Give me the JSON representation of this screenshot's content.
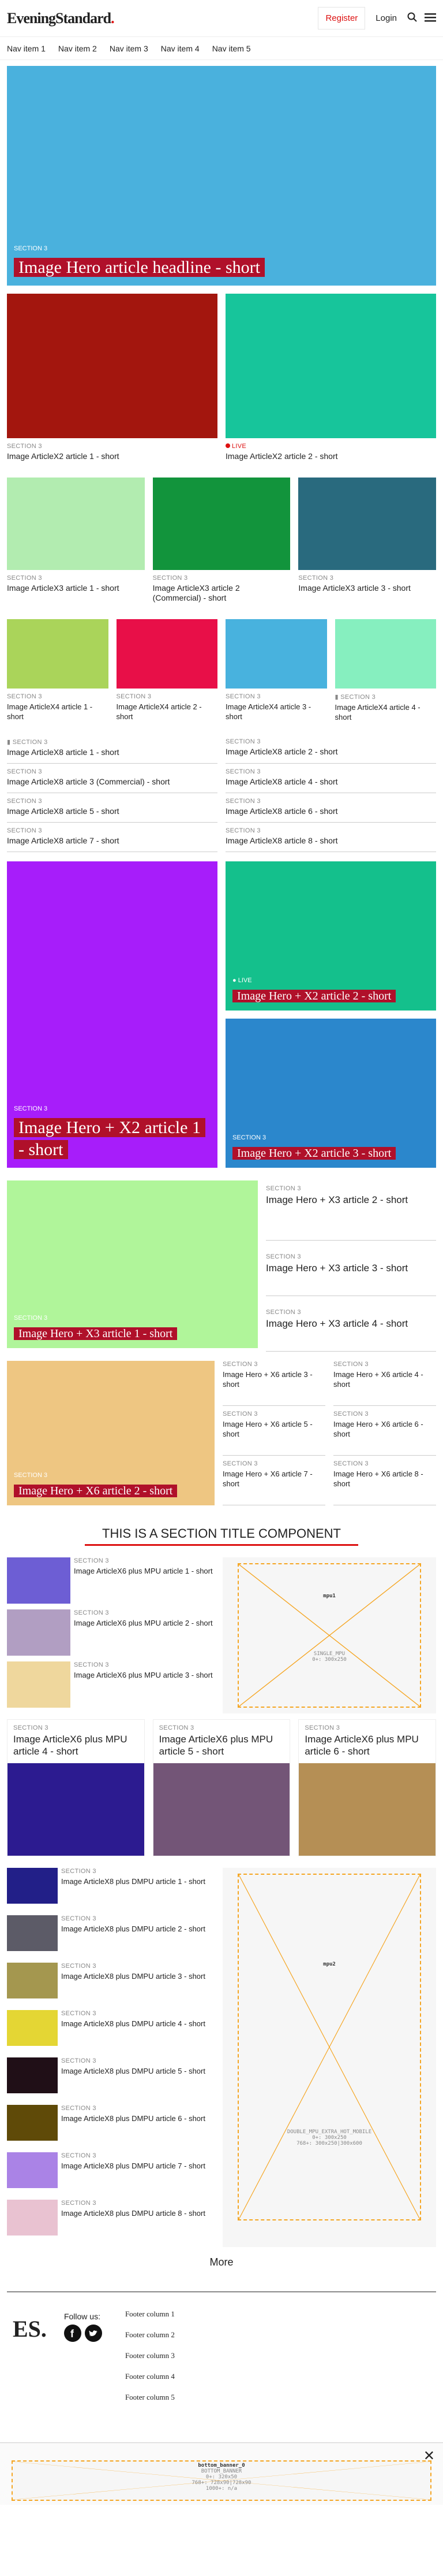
{
  "header": {
    "logo_main": "EveningStandard",
    "logo_dot": ".",
    "register": "Register",
    "login": "Login",
    "search_icon": "search-icon",
    "menu_icon": "menu-icon"
  },
  "nav": [
    "Nav item 1",
    "Nav item 2",
    "Nav item 3",
    "Nav item 4",
    "Nav item 5"
  ],
  "hero": {
    "section": "SECTION 3",
    "title": "Image Hero article headline - short"
  },
  "x2": [
    {
      "section": "SECTION 3",
      "title": "Image ArticleX2 article 1 - short"
    },
    {
      "section": "LIVE",
      "title": "Image ArticleX2 article 2 - short"
    }
  ],
  "x3": [
    {
      "section": "SECTION 3",
      "title": "Image ArticleX3 article 1 - short"
    },
    {
      "section": "SECTION 3",
      "title": "Image ArticleX3 article 2 (Commercial) - short"
    },
    {
      "section": "SECTION 3",
      "title": "Image ArticleX3 article 3 - short"
    }
  ],
  "x4": [
    {
      "section": "SECTION 3",
      "title": "Image ArticleX4 article 1 - short"
    },
    {
      "section": "SECTION 3",
      "title": "Image ArticleX4 article 2 - short"
    },
    {
      "section": "SECTION 3",
      "title": "Image ArticleX4 article 3 - short"
    },
    {
      "section": "SECTION 3",
      "title": "Image ArticleX4 article 4 - short"
    }
  ],
  "x8": [
    {
      "section": "SECTION 3",
      "title": "Image ArticleX8 article 1 - short"
    },
    {
      "section": "SECTION 3",
      "title": "Image ArticleX8 article 2 - short"
    },
    {
      "section": "SECTION 3",
      "title": "Image ArticleX8 article 3 (Commercial) - short"
    },
    {
      "section": "SECTION 3",
      "title": "Image ArticleX8 article 4 - short"
    },
    {
      "section": "SECTION 3",
      "title": "Image ArticleX8 article 5 - short"
    },
    {
      "section": "SECTION 3",
      "title": "Image ArticleX8 article 6 - short"
    },
    {
      "section": "SECTION 3",
      "title": "Image ArticleX8 article 7 - short"
    },
    {
      "section": "SECTION 3",
      "title": "Image ArticleX8 article 8 - short"
    }
  ],
  "hx2": [
    {
      "section": "SECTION 3",
      "title": "Image Hero + X2 article 1 - short"
    },
    {
      "section": "LIVE",
      "title": "Image Hero + X2 article 2 - short"
    },
    {
      "section": "SECTION 3",
      "title": "Image Hero + X2 article 3 - short"
    }
  ],
  "hx3": [
    {
      "section": "SECTION 3",
      "title": "Image Hero + X3 article 1 - short"
    },
    {
      "section": "SECTION 3",
      "title": "Image Hero + X3 article 2 - short"
    },
    {
      "section": "SECTION 3",
      "title": "Image Hero + X3 article 3 - short"
    },
    {
      "section": "SECTION 3",
      "title": "Image Hero + X3 article 4 - short"
    }
  ],
  "hx6": [
    {
      "section": "SECTION 3",
      "title": "Image Hero + X6 article 2 - short"
    },
    {
      "section": "SECTION 3",
      "title": "Image Hero + X6 article 3 - short"
    },
    {
      "section": "SECTION 3",
      "title": "Image Hero + X6 article 4 - short"
    },
    {
      "section": "SECTION 3",
      "title": "Image Hero + X6 article 5 - short"
    },
    {
      "section": "SECTION 3",
      "title": "Image Hero + X6 article 6 - short"
    },
    {
      "section": "SECTION 3",
      "title": "Image Hero + X6 article 7 - short"
    },
    {
      "section": "SECTION 3",
      "title": "Image Hero + X6 article 8 - short"
    }
  ],
  "section_title": "THIS IS A SECTION TITLE COMPONENT",
  "mpu_list": [
    {
      "section": "SECTION 3",
      "title": "Image ArticleX6 plus MPU article 1 - short"
    },
    {
      "section": "SECTION 3",
      "title": "Image ArticleX6 plus MPU article 2 - short"
    },
    {
      "section": "SECTION 3",
      "title": "Image ArticleX6 plus MPU article 3 - short"
    },
    {
      "section": "SECTION 3",
      "title": "Image ArticleX6 plus MPU article 4 - short"
    },
    {
      "section": "SECTION 3",
      "title": "Image ArticleX6 plus MPU article 5 - short"
    },
    {
      "section": "SECTION 3",
      "title": "Image ArticleX6 plus MPU article 6 - short"
    }
  ],
  "mpu1": {
    "name": "mpu1",
    "l1": "SINGLE_MPU",
    "l2": "0+: 300x250"
  },
  "dmpu_list": [
    {
      "section": "SECTION 3",
      "title": "Image ArticleX8 plus DMPU article 1 - short"
    },
    {
      "section": "SECTION 3",
      "title": "Image ArticleX8 plus DMPU article 2 - short"
    },
    {
      "section": "SECTION 3",
      "title": "Image ArticleX8 plus DMPU article 3 - short"
    },
    {
      "section": "SECTION 3",
      "title": "Image ArticleX8 plus DMPU article 4 - short"
    },
    {
      "section": "SECTION 3",
      "title": "Image ArticleX8 plus DMPU article 5 - short"
    },
    {
      "section": "SECTION 3",
      "title": "Image ArticleX8 plus DMPU article 6 - short"
    },
    {
      "section": "SECTION 3",
      "title": "Image ArticleX8 plus DMPU article 7 - short"
    },
    {
      "section": "SECTION 3",
      "title": "Image ArticleX8 plus DMPU article 8 - short"
    }
  ],
  "mpu2": {
    "name": "mpu2",
    "l1": "DOUBLE_MPU_EXTRA_HOT_MOBILE",
    "l2": "0+: 300x250",
    "l3": "768+: 300x250|300x600"
  },
  "more": "More",
  "footer": {
    "logo": "ES.",
    "follow": "Follow us:",
    "cols": [
      "Footer column 1",
      "Footer column 2",
      "Footer column 3",
      "Footer column 4",
      "Footer column 5"
    ]
  },
  "banner": {
    "name": "bottom_banner_0",
    "l1": "BOTTOM_BANNER",
    "l2": "0+: 320x50",
    "l3": "768+: 728x90|728x90",
    "l4": "1000+: n/a"
  },
  "colors": {
    "accent": "#d11",
    "hero": "#4ab1dd",
    "x2": [
      "#a3160e",
      "#17c59b"
    ],
    "x3": [
      "#b2ecb0",
      "#12943c",
      "#296a7e"
    ],
    "x4": [
      "#aad45a",
      "#e80f48",
      "#48b2de",
      "#86efbf"
    ],
    "hx2": [
      "#a71dfa",
      "#14c08c",
      "#2b87cc"
    ],
    "hx3": "#b0f59a",
    "hx6": "#eec682",
    "mpu": [
      "#6d5ed4",
      "#b19ec2",
      "#efd79d",
      "#2c1b90",
      "#735577",
      "#b58f55"
    ],
    "dmpu": [
      "#221f88",
      "#5c5b67",
      "#a4974f",
      "#e4d634",
      "#200f17",
      "#5f4a08",
      "#aa83e6",
      "#e9c2d1"
    ]
  }
}
